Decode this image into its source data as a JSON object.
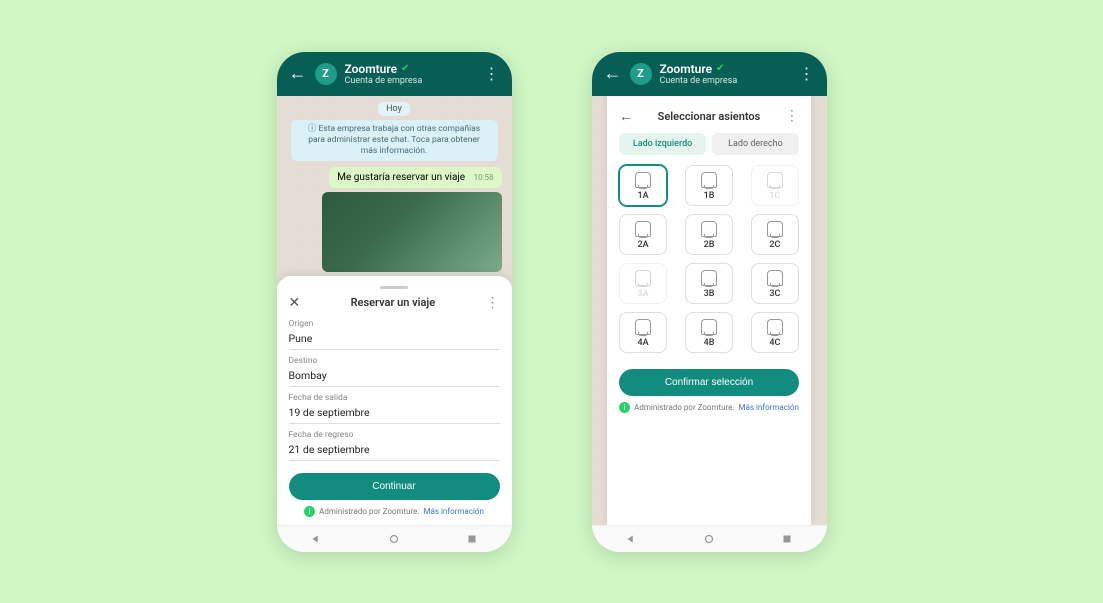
{
  "phone1": {
    "header": {
      "business": "Zoomture",
      "subtitle": "Cuenta de empresa",
      "avatar_letter": "Z"
    },
    "chat": {
      "date": "Hoy",
      "info": "Esta empresa trabaja con otras compañías para administrar este chat. Toca para obtener más información.",
      "msg": "Me gustaría reservar un viaje",
      "msg_time": "10:58"
    },
    "sheet": {
      "title": "Reservar un viaje",
      "fields": {
        "origin_label": "Origen",
        "origin_value": "Pune",
        "dest_label": "Destino",
        "dest_value": "Bombay",
        "depart_label": "Fecha de salida",
        "depart_value": "19 de septiembre",
        "return_label": "Fecha de regreso",
        "return_value": "21 de septiembre"
      },
      "cta": "Continuar",
      "footer_text": "Administrado por Zoomture.",
      "footer_link": "Más información"
    }
  },
  "phone2": {
    "header": {
      "business": "Zoomture",
      "subtitle": "Cuenta de empresa",
      "avatar_letter": "Z"
    },
    "sheet": {
      "title": "Seleccionar asientos",
      "tab_left": "Lado izquierdo",
      "tab_right": "Lado derecho",
      "seats": [
        {
          "label": "1A",
          "state": "selected"
        },
        {
          "label": "1B",
          "state": "normal"
        },
        {
          "label": "1C",
          "state": "disabled"
        },
        {
          "label": "2A",
          "state": "normal"
        },
        {
          "label": "2B",
          "state": "normal"
        },
        {
          "label": "2C",
          "state": "normal"
        },
        {
          "label": "3A",
          "state": "disabled"
        },
        {
          "label": "3B",
          "state": "normal"
        },
        {
          "label": "3C",
          "state": "normal"
        },
        {
          "label": "4A",
          "state": "normal"
        },
        {
          "label": "4B",
          "state": "normal"
        },
        {
          "label": "4C",
          "state": "normal"
        }
      ],
      "cta": "Confirmar selección",
      "footer_text": "Administrado por Zoomture.",
      "footer_link": "Más información"
    }
  }
}
